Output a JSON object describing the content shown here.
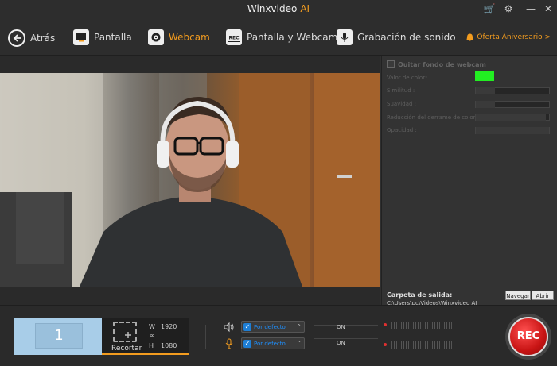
{
  "window": {
    "title_main": "Winxvideo",
    "title_ai": "AI",
    "controls": {
      "cart": "🛒",
      "settings": "⚙",
      "minimize": "—",
      "close": "✕"
    }
  },
  "nav": {
    "back": "Atrás",
    "items": [
      {
        "label": "Pantalla",
        "icon": "screen-icon"
      },
      {
        "label": "Webcam",
        "icon": "webcam-icon",
        "active": true
      },
      {
        "label": "Pantalla y Webcam",
        "icon": "rec-icon"
      },
      {
        "label": "Grabación de sonido",
        "icon": "microphone-icon"
      }
    ],
    "offer": "Oferta Aniversario >"
  },
  "panel": {
    "remove_bg": "Quitar fondo de webcam",
    "labels": {
      "color": "Valor de color:",
      "similarity": "Similitud :",
      "smoothness": "Suavidad :",
      "spill": "Reducción del derrame de color :",
      "opacity": "Opacidad :"
    },
    "color_value": "#22ee22",
    "output_title": "Carpeta de salida:",
    "output_path": "C:\\Users\\pc\\Videos\\Winxvideo AI",
    "browse": "Navegar",
    "open": "Abrir"
  },
  "bottom": {
    "screen_number": "1",
    "crop": "Recortar",
    "w_label": "W",
    "w_value": "1920",
    "h_label": "H",
    "h_value": "1080",
    "speaker_source": "Por defecto",
    "mic_source": "Por defecto",
    "speaker_state": "ON",
    "mic_state": "ON",
    "rec": "REC"
  },
  "colors": {
    "accent": "#f39c1f",
    "rec_red": "#d11a1a",
    "link_blue": "#1e90ff"
  }
}
